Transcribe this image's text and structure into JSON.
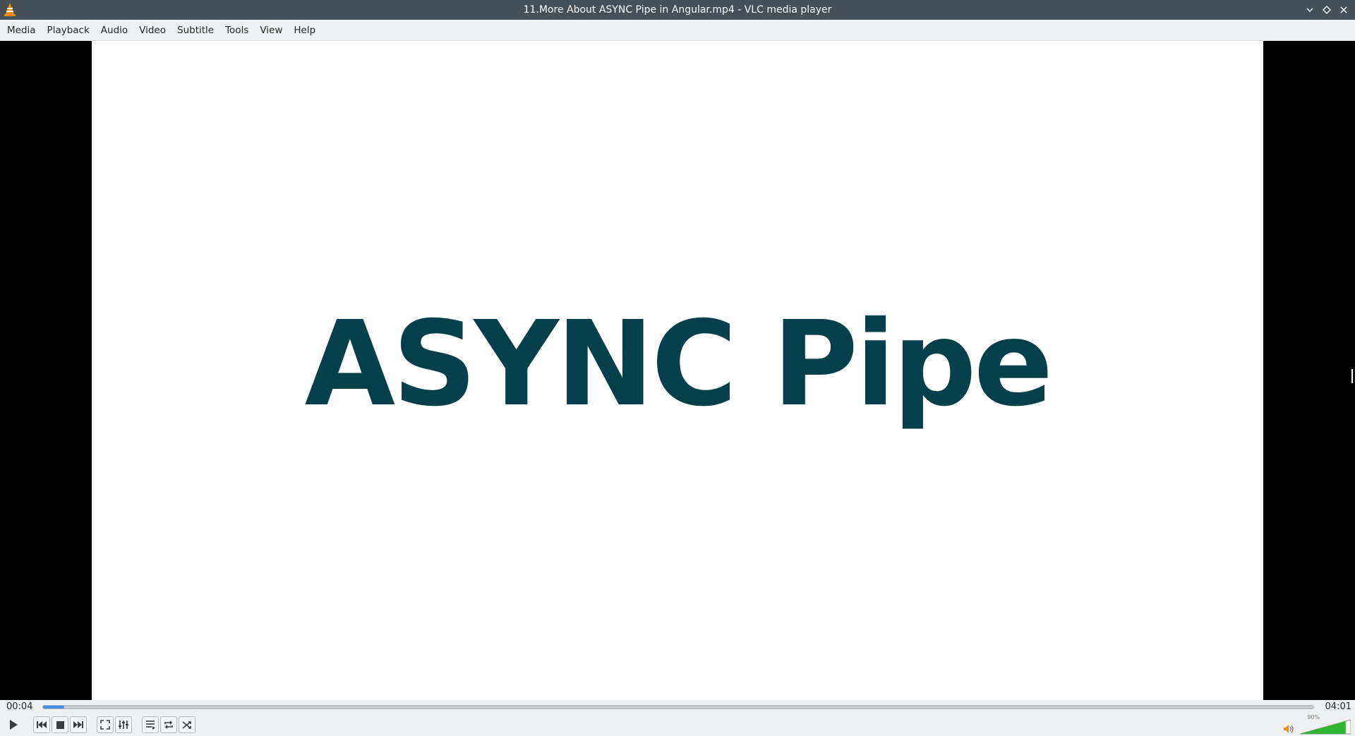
{
  "window": {
    "title": "11.More About ASYNC Pipe in Angular.mp4 - VLC media player",
    "app_icon": "vlc-cone-icon"
  },
  "menu": [
    "Media",
    "Playback",
    "Audio",
    "Video",
    "Subtitle",
    "Tools",
    "View",
    "Help"
  ],
  "video": {
    "frame_text": "ASYNC Pipe",
    "text_color": "#063f4c"
  },
  "playback": {
    "elapsed": "00:04",
    "total": "04:01",
    "progress_fraction": 0.0166
  },
  "volume": {
    "label": "90%",
    "level_fraction": 0.9,
    "color": "#2fb52f"
  },
  "controls": {
    "icons": [
      "play-icon",
      "previous-icon",
      "stop-icon",
      "next-icon",
      "fullscreen-icon",
      "extended-settings-icon",
      "playlist-icon",
      "loop-icon",
      "shuffle-icon",
      "speaker-icon"
    ]
  },
  "colors": {
    "titlebar": "#475057",
    "menubar": "#eff0f1",
    "accent": "#3d8ee6"
  }
}
